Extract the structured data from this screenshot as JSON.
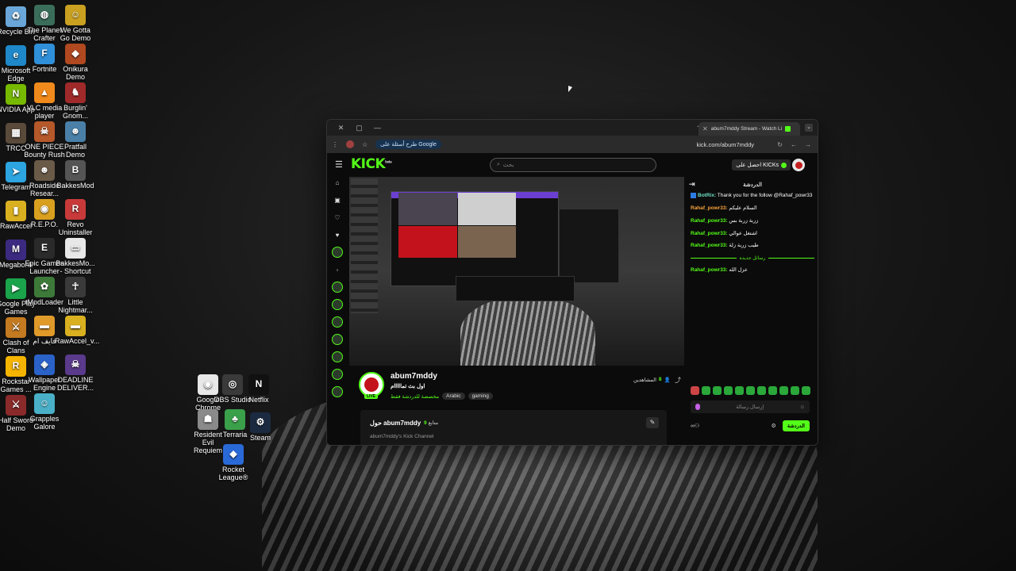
{
  "desktop": {
    "icons_col1": [
      {
        "label": "Recycle Bin",
        "color": "#6aa7d8",
        "glyph": "♻"
      },
      {
        "label": "Microsoft Edge",
        "color": "#1e88c8",
        "glyph": "e"
      },
      {
        "label": "NVIDIA App",
        "color": "#76b900",
        "glyph": "N"
      },
      {
        "label": "TRCC",
        "color": "#5a4a3a",
        "glyph": "▦"
      },
      {
        "label": "Telegram",
        "color": "#2ca5e0",
        "glyph": "➤"
      },
      {
        "label": "RawAccel",
        "color": "#d9b020",
        "glyph": "▮"
      },
      {
        "label": "Megabonk",
        "color": "#3b2a80",
        "glyph": "M"
      },
      {
        "label": "Google Play Games",
        "color": "#1aa34a",
        "glyph": "▶"
      },
      {
        "label": "Clash of Clans",
        "color": "#c47a20",
        "glyph": "⚔"
      },
      {
        "label": "Rockstar Games ...",
        "color": "#f5b400",
        "glyph": "R"
      },
      {
        "label": "Half Sword Demo",
        "color": "#8a2a2a",
        "glyph": "⚔"
      }
    ],
    "icons_col2": [
      {
        "label": "The Planet Crafter",
        "color": "#3b6e5a",
        "glyph": "◍"
      },
      {
        "label": "Fortnite",
        "color": "#2f8fd8",
        "glyph": "F"
      },
      {
        "label": "VLC media player",
        "color": "#f08a1c",
        "glyph": "▲"
      },
      {
        "label": "ONE PIECE Bounty Rush",
        "color": "#b5582a",
        "glyph": "☠"
      },
      {
        "label": "Roadside Resear...",
        "color": "#6a5a48",
        "glyph": "☻"
      },
      {
        "label": "R.E.P.O.",
        "color": "#d9a020",
        "glyph": "◉"
      },
      {
        "label": "Epic Games Launcher",
        "color": "#2a2a2a",
        "glyph": "E"
      },
      {
        "label": "tModLoader",
        "color": "#3d7a3a",
        "glyph": "✿"
      },
      {
        "label": "فايف ام",
        "color": "#e09a2a",
        "glyph": "▬"
      },
      {
        "label": "Wallpaper Engine",
        "color": "#2a62c8",
        "glyph": "◈"
      },
      {
        "label": "Grapples Galore",
        "color": "#4ab0c8",
        "glyph": "☺"
      }
    ],
    "icons_col3": [
      {
        "label": "We Gotta Go Demo",
        "color": "#c9a020",
        "glyph": "☺"
      },
      {
        "label": "Onikura Demo",
        "color": "#b04820",
        "glyph": "◆"
      },
      {
        "label": "Burglin' Gnom...",
        "color": "#a02a2a",
        "glyph": "♞"
      },
      {
        "label": "Pratfall Demo",
        "color": "#4a80a8",
        "glyph": "☻"
      },
      {
        "label": "BakkesMod",
        "color": "#555555",
        "glyph": "B"
      },
      {
        "label": "Revo Uninstaller",
        "color": "#c83a3a",
        "glyph": "R"
      },
      {
        "label": "BakkesMo... - Shortcut",
        "color": "#e8e8e8",
        "glyph": "▭"
      },
      {
        "label": "Little Nightmar...",
        "color": "#3a3a3a",
        "glyph": "☥"
      },
      {
        "label": "RawAccel_v...",
        "color": "#d9b020",
        "glyph": "▬"
      },
      {
        "label": "DEADLINE DELIVER...",
        "color": "#5a3a8a",
        "glyph": "☠"
      }
    ],
    "icons_mid": [
      {
        "label": "Google Chrome",
        "color": "#e8e8e8",
        "glyph": "◉"
      },
      {
        "label": "OBS Studio",
        "color": "#3a3a3a",
        "glyph": "◎"
      },
      {
        "label": "Netflix",
        "color": "#111111",
        "glyph": "N"
      },
      {
        "label": "Resident Evil Requiem",
        "color": "#8a8a8a",
        "glyph": "☗"
      },
      {
        "label": "Terraria",
        "color": "#3aa04a",
        "glyph": "♣"
      },
      {
        "label": "Steam",
        "color": "#1b2a40",
        "glyph": "⚙"
      },
      {
        "label": "Rocket League®",
        "color": "#2a6ad8",
        "glyph": "◆"
      }
    ]
  },
  "browser": {
    "tab_title": "abum7mddy Stream - Watch Li",
    "window_controls": [
      "✕",
      "▢",
      "—"
    ],
    "new_tab": "+",
    "google_chip": "طرح أسئلة على Google",
    "url": "kick.com/abum7mddy",
    "nav_icons": [
      "↻",
      "←",
      "→"
    ]
  },
  "kick": {
    "logo": "KICK",
    "logo_tag": "beta",
    "search_placeholder": "بحث",
    "kicks_button": "احصل على KICKs",
    "channel": {
      "name": "abum7mddy",
      "title": "اول بث تمااااام",
      "category": "مخصصة للدردشة فقط",
      "tags": [
        "Arabic",
        "gaming"
      ],
      "live": "LIVE",
      "viewers_label": "المشاهدين",
      "viewers_count": "8"
    },
    "about": {
      "title": "حول abum7mddy",
      "followers_label": "متابع",
      "followers_count": "9",
      "description": "abum7mddy's Kick Channel"
    },
    "chat": {
      "header": "الدردشة",
      "messages": [
        {
          "user": "BotRix:",
          "text": " Thank you for the follow @Rahaf_powr33",
          "kind": "bot"
        },
        {
          "user": "Rahaf_powr33:",
          "text": " السلام عليكم",
          "kind": "orange"
        },
        {
          "user": "Rahaf_powr33:",
          "text": " زربة زربة بس",
          "kind": "green"
        },
        {
          "user": "Rahaf_powr33:",
          "text": " اشتغل عوالي",
          "kind": "green"
        },
        {
          "user": "Rahaf_powr33:",
          "text": " طيب زربة زلة",
          "kind": "green"
        }
      ],
      "new_messages": "رسائل جديدة",
      "late_message": {
        "user": "Rahaf_powr33:",
        "text": " عزل الله"
      },
      "input_placeholder": "إرسال رسالة",
      "send": "الدردشة"
    }
  },
  "colors": {
    "kick_green": "#53fc18",
    "chat_orange": "#f7a23a"
  }
}
